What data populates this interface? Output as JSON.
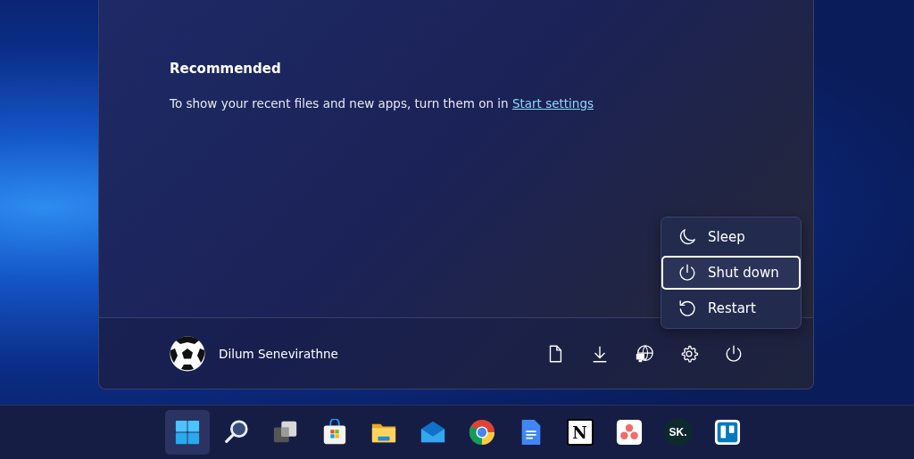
{
  "start_menu": {
    "recommended": {
      "title": "Recommended",
      "message": "To show your recent files and new apps, turn them on in ",
      "link": "Start settings"
    },
    "power_menu": [
      {
        "label": "Sleep",
        "kind": "sleep",
        "selected": false
      },
      {
        "label": "Shut down",
        "kind": "shutdown",
        "selected": true
      },
      {
        "label": "Restart",
        "kind": "restart",
        "selected": false
      }
    ],
    "user": {
      "name": "Dilum Senevirathne"
    },
    "footer_buttons": [
      {
        "kind": "document"
      },
      {
        "kind": "download"
      },
      {
        "kind": "network"
      },
      {
        "kind": "settings"
      },
      {
        "kind": "power"
      }
    ]
  },
  "taskbar": [
    {
      "kind": "start",
      "selected": true
    },
    {
      "kind": "search",
      "selected": false
    },
    {
      "kind": "taskview",
      "selected": false
    },
    {
      "kind": "store",
      "selected": false
    },
    {
      "kind": "folder",
      "selected": false
    },
    {
      "kind": "mail",
      "selected": false
    },
    {
      "kind": "browser",
      "selected": false
    },
    {
      "kind": "docs",
      "selected": false
    },
    {
      "kind": "notion",
      "label": "N",
      "selected": false
    },
    {
      "kind": "dots",
      "selected": false
    },
    {
      "kind": "sk",
      "label": "SK.",
      "selected": false
    },
    {
      "kind": "board",
      "selected": false
    }
  ]
}
